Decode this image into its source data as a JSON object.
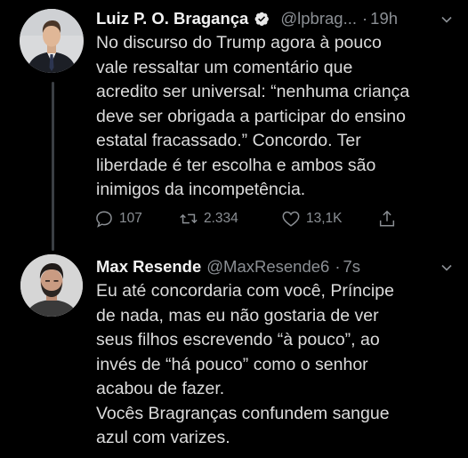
{
  "tweets": [
    {
      "author_name": "Luiz P. O. Bragança",
      "handle": "@lpbrag...",
      "time": "19h",
      "text": "No discurso do Trump agora à pouco\nvale ressaltar um comentário que\nacredito ser universal:  “nenhuma criança\ndeve ser obrigada a participar do ensino\nestatal fracassado.” Concordo.  Ter\nliberdade é ter escolha e ambos são\ninimigos da incompetência.",
      "verified": true,
      "stats": {
        "replies": "107",
        "retweets": "2.334",
        "likes": "13,1K"
      }
    },
    {
      "author_name": "Max Resende",
      "handle": "@MaxResende6",
      "time": "7s",
      "text": "Eu até concordaria com você, Príncipe\nde nada, mas eu não gostaria de ver\nseus filhos escrevendo “à pouco”, ao\ninvés de “há pouco” como o senhor\nacabou de fazer.\nVocês Bragranças confundem sangue\nazul com varizes.",
      "verified": false
    }
  ],
  "icons": {
    "verified": "verified-badge-icon",
    "caret": "chevron-down-icon",
    "reply": "reply-icon",
    "retweet": "retweet-icon",
    "like": "heart-icon",
    "share": "share-icon"
  },
  "colors": {
    "background": "#000000",
    "text": "#dcdcdc",
    "secondary": "#8b8f94",
    "thread_line": "#3b3f44"
  }
}
